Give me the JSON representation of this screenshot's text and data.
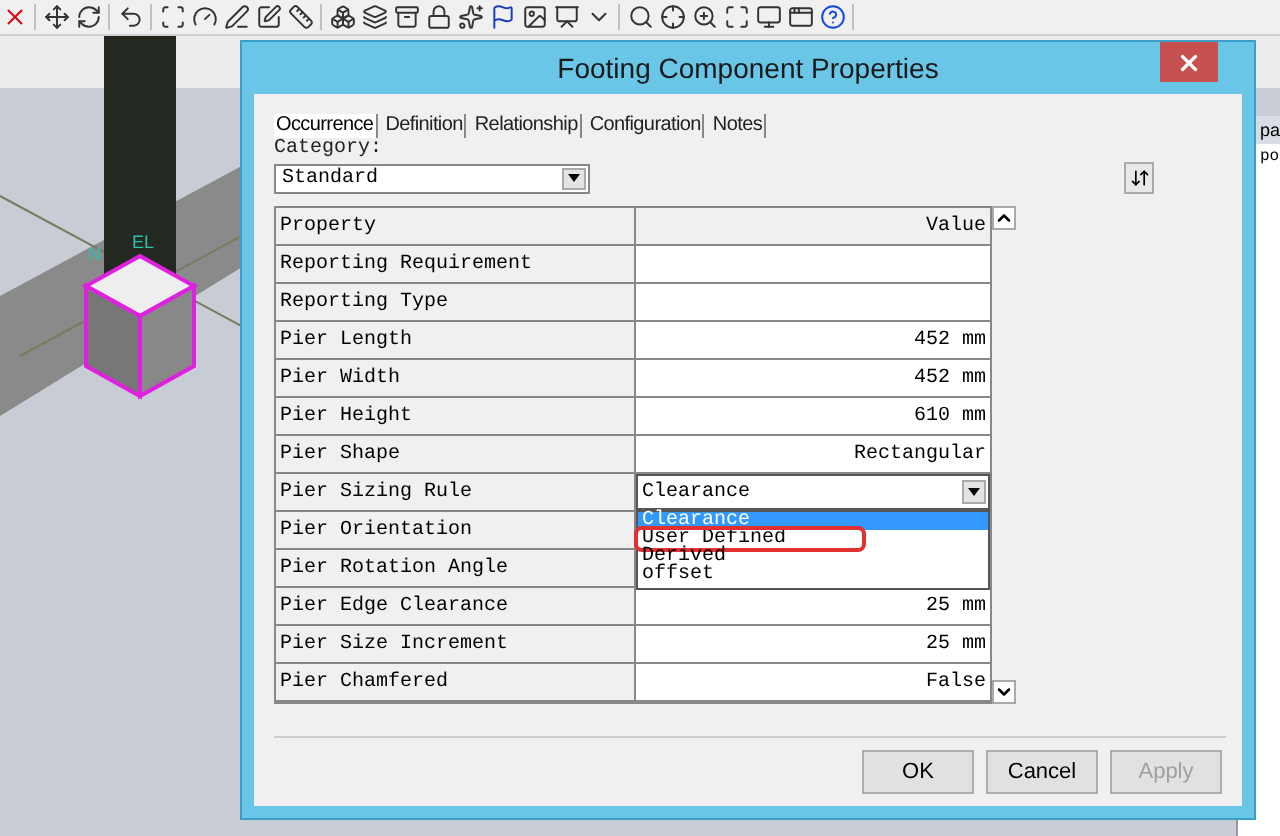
{
  "viewport": {
    "labels": [
      "N",
      "EL"
    ]
  },
  "side_panel": {
    "header": "pa",
    "cell": "po"
  },
  "dialog": {
    "title": "Footing Component Properties",
    "tabs": [
      {
        "label": "Occurrence",
        "selected": true
      },
      {
        "label": "Definition",
        "selected": false
      },
      {
        "label": "Relationship",
        "selected": false
      },
      {
        "label": "Configuration",
        "selected": false
      },
      {
        "label": "Notes",
        "selected": false
      }
    ],
    "category": {
      "label": "Category:",
      "value": "Standard"
    },
    "table": {
      "columns": [
        "Property",
        "Value"
      ],
      "rows": [
        {
          "property": "Reporting Requirement",
          "value": ""
        },
        {
          "property": "Reporting Type",
          "value": ""
        },
        {
          "property": "Pier Length",
          "value": "452 mm"
        },
        {
          "property": "Pier Width",
          "value": "452 mm"
        },
        {
          "property": "Pier Height",
          "value": "610 mm"
        },
        {
          "property": "Pier Shape",
          "value": "Rectangular"
        },
        {
          "property": "Pier Sizing Rule",
          "value": "Clearance",
          "kind": "dropdown",
          "expanded": true,
          "options": [
            {
              "label": "Clearance",
              "selected": true,
              "highlighted": false
            },
            {
              "label": "User Defined",
              "selected": false,
              "highlighted": true
            },
            {
              "label": "Derived",
              "selected": false,
              "highlighted": false
            },
            {
              "label": "offset",
              "selected": false,
              "highlighted": false
            }
          ]
        },
        {
          "property": "Pier Orientation",
          "value": ""
        },
        {
          "property": "Pier Rotation Angle",
          "value": ""
        },
        {
          "property": "Pier Edge Clearance",
          "value": "25 mm"
        },
        {
          "property": "Pier Size Increment",
          "value": "25 mm"
        },
        {
          "property": "Pier Chamfered",
          "value": "False"
        }
      ]
    },
    "buttons": [
      {
        "label": "OK",
        "disabled": false
      },
      {
        "label": "Cancel",
        "disabled": false
      },
      {
        "label": "Apply",
        "disabled": true
      }
    ]
  }
}
